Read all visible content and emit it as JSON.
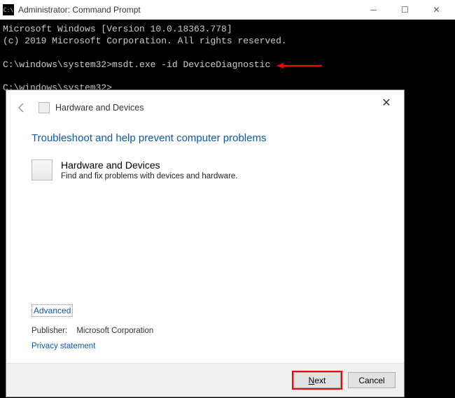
{
  "cmd": {
    "title": "Administrator: Command Prompt",
    "line1": "Microsoft Windows [Version 10.0.18363.778]",
    "line2": "(c) 2019 Microsoft Corporation. All rights reserved.",
    "prompt1": "C:\\windows\\system32>",
    "command": "msdt.exe -id DeviceDiagnostic",
    "prompt2": "C:\\windows\\system32>"
  },
  "dialog": {
    "header": "Hardware and Devices",
    "heading": "Troubleshoot and help prevent computer problems",
    "item_title": "Hardware and Devices",
    "item_desc": "Find and fix problems with devices and hardware.",
    "advanced": "Advanced",
    "publisher_label": "Publisher:",
    "publisher_value": "Microsoft Corporation",
    "privacy": "Privacy statement",
    "next": "Next",
    "cancel": "Cancel"
  }
}
